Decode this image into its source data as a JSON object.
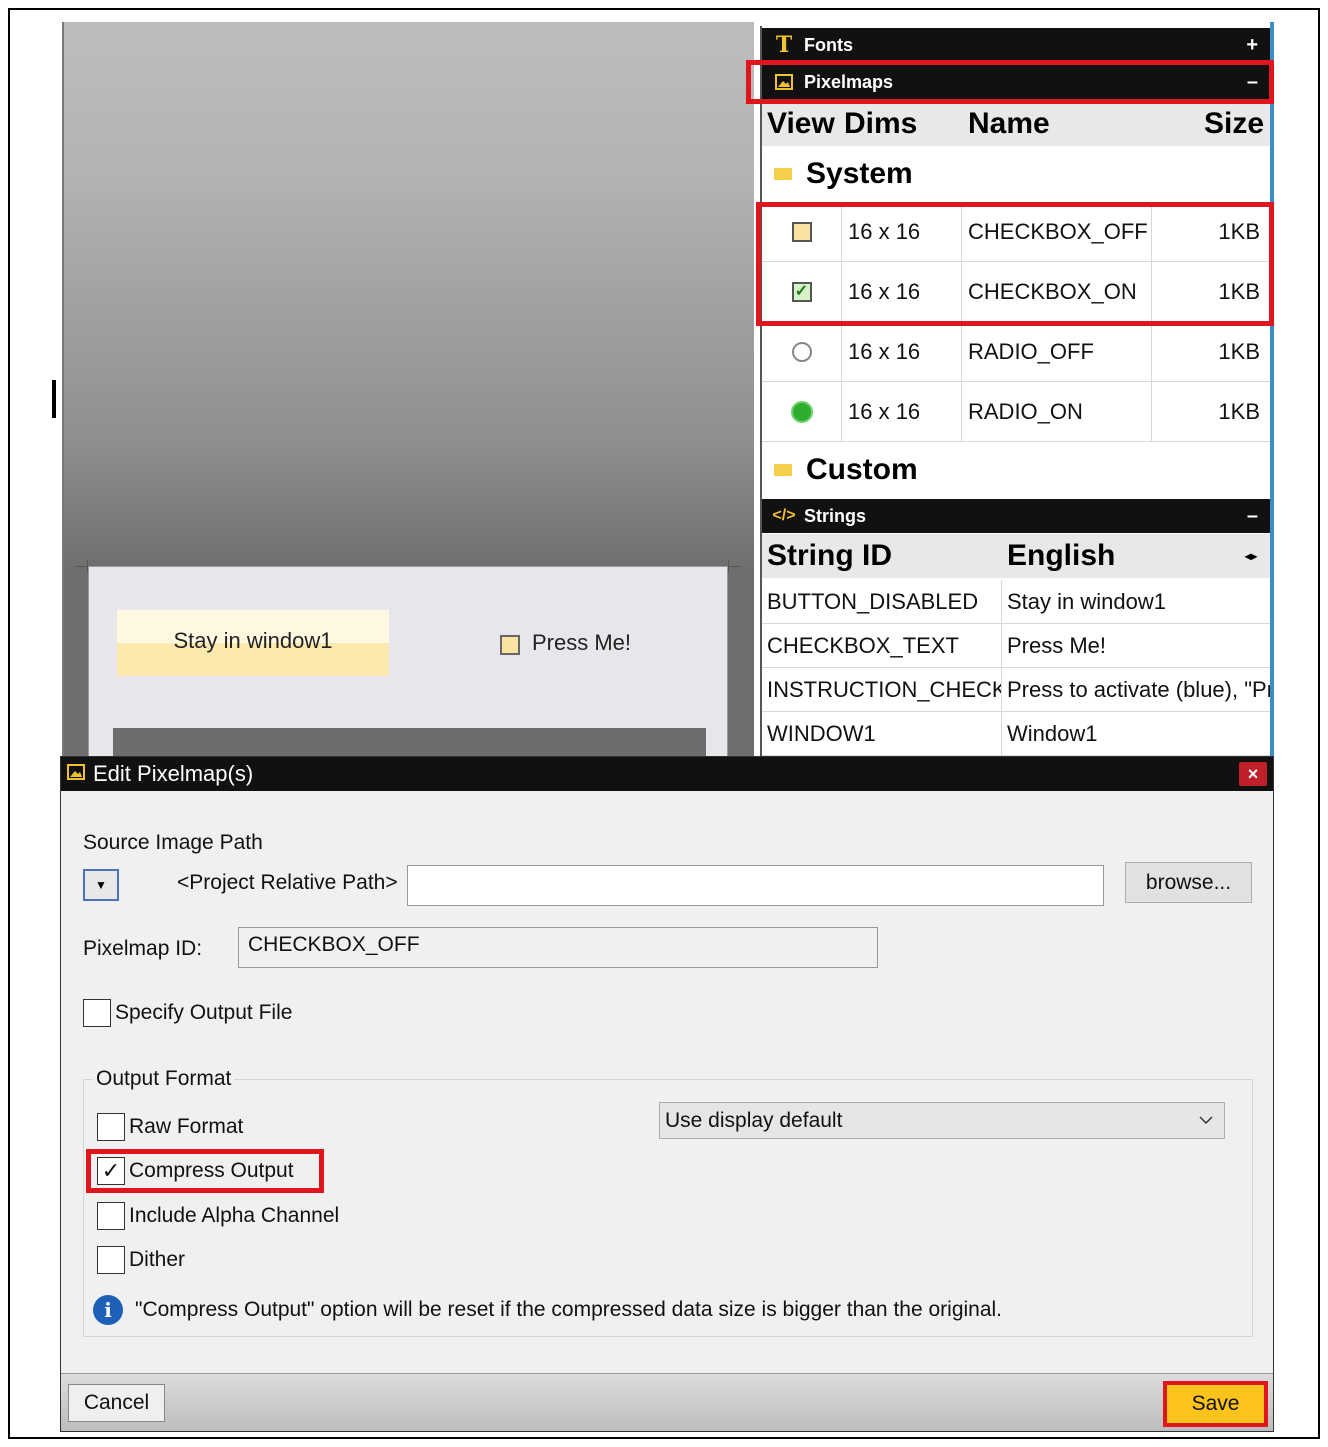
{
  "canvas": {
    "stay_button": "Stay in window1",
    "press_me": "Press Me!"
  },
  "panels": {
    "fonts": {
      "title": "Fonts",
      "toggle": "+",
      "icon": "T"
    },
    "pixelmaps": {
      "title": "Pixelmaps",
      "toggle": "–",
      "columns": [
        "View",
        "Dims",
        "Name",
        "Size"
      ],
      "groups": {
        "system": "System",
        "custom": "Custom"
      },
      "rows": [
        {
          "icon": "checkbox-off-icon",
          "dims": "16 x 16",
          "name": "CHECKBOX_OFF",
          "size": "1KB"
        },
        {
          "icon": "checkbox-on-icon",
          "dims": "16 x 16",
          "name": "CHECKBOX_ON",
          "size": "1KB"
        },
        {
          "icon": "radio-off-icon",
          "dims": "16 x 16",
          "name": "RADIO_OFF",
          "size": "1KB"
        },
        {
          "icon": "radio-on-icon",
          "dims": "16 x 16",
          "name": "RADIO_ON",
          "size": "1KB"
        }
      ]
    },
    "strings": {
      "title": "Strings",
      "toggle": "–",
      "columns": [
        "String ID",
        "English"
      ],
      "rows": [
        {
          "id": "BUTTON_DISABLED",
          "english": "Stay in window1"
        },
        {
          "id": "CHECKBOX_TEXT",
          "english": "Press Me!"
        },
        {
          "id": "INSTRUCTION_CHECKI",
          "english": "Press to activate (blue), \"Pre"
        },
        {
          "id": "WINDOW1",
          "english": "Window1"
        }
      ]
    }
  },
  "dialog": {
    "title": "Edit Pixelmap(s)",
    "close": "×",
    "source_image_path_label": "Source Image Path",
    "path_mode": "<Project Relative Path>",
    "path_value": "",
    "browse": "browse...",
    "pixelmap_id_label": "Pixelmap ID:",
    "pixelmap_id_value": "CHECKBOX_OFF",
    "specify_output_file": {
      "label": "Specify Output File",
      "checked": false
    },
    "output_format_legend": "Output Format",
    "raw_format": {
      "label": "Raw Format",
      "checked": false
    },
    "compress_output": {
      "label": "Compress Output",
      "checked": true,
      "mark": "✓"
    },
    "include_alpha": {
      "label": "Include Alpha Channel",
      "checked": false
    },
    "dither": {
      "label": "Dither",
      "checked": false
    },
    "format_select": "Use display default",
    "info_icon": "i",
    "info_text": "\"Compress Output\" option will be reset if the compressed data size is bigger than the original.",
    "cancel": "Cancel",
    "save": "Save"
  },
  "colors": {
    "highlight": "#e0161e",
    "save_button": "#fbc31c",
    "panel_header": "#111111",
    "accent_edge": "#3c8ec9"
  }
}
